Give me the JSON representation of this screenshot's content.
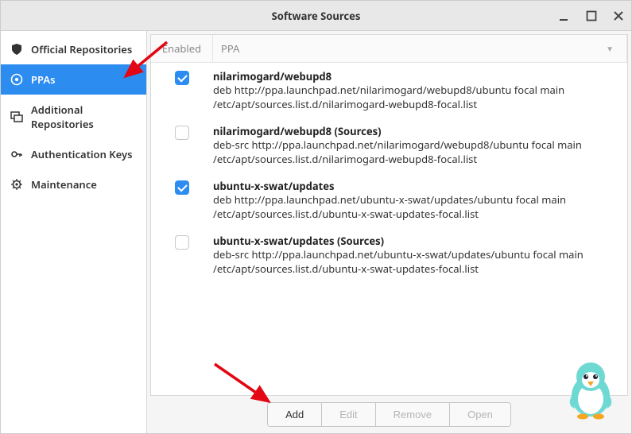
{
  "window": {
    "title": "Software Sources"
  },
  "sidebar": {
    "items": [
      {
        "label": "Official Repositories"
      },
      {
        "label": "PPAs"
      },
      {
        "label": "Additional Repositories"
      },
      {
        "label": "Authentication Keys"
      },
      {
        "label": "Maintenance"
      }
    ]
  },
  "table": {
    "header_enabled": "Enabled",
    "header_ppa": "PPA",
    "rows": [
      {
        "enabled": true,
        "title": "nilarimogard/webupd8",
        "line1": "deb http://ppa.launchpad.net/nilarimogard/webupd8/ubuntu focal main",
        "line2": "/etc/apt/sources.list.d/nilarimogard-webupd8-focal.list"
      },
      {
        "enabled": false,
        "title": "nilarimogard/webupd8 (Sources)",
        "line1": "deb-src http://ppa.launchpad.net/nilarimogard/webupd8/ubuntu focal main",
        "line2": "/etc/apt/sources.list.d/nilarimogard-webupd8-focal.list"
      },
      {
        "enabled": true,
        "title": "ubuntu-x-swat/updates",
        "line1": "deb http://ppa.launchpad.net/ubuntu-x-swat/updates/ubuntu focal main",
        "line2": "/etc/apt/sources.list.d/ubuntu-x-swat-updates-focal.list"
      },
      {
        "enabled": false,
        "title": "ubuntu-x-swat/updates (Sources)",
        "line1": "deb-src http://ppa.launchpad.net/ubuntu-x-swat/updates/ubuntu focal main",
        "line2": "/etc/apt/sources.list.d/ubuntu-x-swat-updates-focal.list"
      }
    ]
  },
  "buttons": {
    "add": "Add",
    "edit": "Edit",
    "remove": "Remove",
    "open": "Open"
  }
}
